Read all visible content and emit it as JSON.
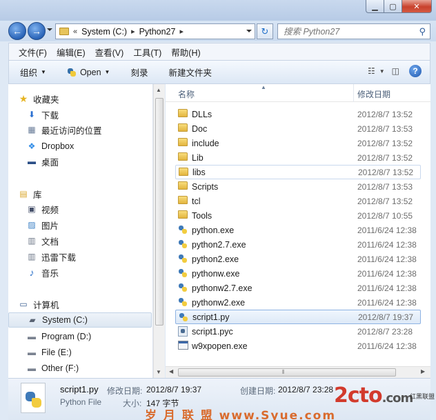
{
  "address": {
    "crumbs": [
      "System (C:)",
      "Python27"
    ],
    "crumb_prefix": "«",
    "search_placeholder": "搜索 Python27"
  },
  "menu": [
    "文件(F)",
    "编辑(E)",
    "查看(V)",
    "工具(T)",
    "帮助(H)"
  ],
  "toolbar": {
    "organize": "组织",
    "open": "Open",
    "burn": "刻录",
    "new_folder": "新建文件夹"
  },
  "nav": {
    "favorites": {
      "header": "收藏夹",
      "items": [
        "下载",
        "最近访问的位置",
        "Dropbox",
        "桌面"
      ]
    },
    "libraries": {
      "header": "库",
      "items": [
        "视频",
        "图片",
        "文档",
        "迅雷下载",
        "音乐"
      ]
    },
    "computer": {
      "header": "计算机",
      "items": [
        "System (C:)",
        "Program (D:)",
        "File (E:)",
        "Other (F:)"
      ]
    }
  },
  "columns": {
    "name": "名称",
    "modified": "修改日期"
  },
  "files": [
    {
      "name": "DLLs",
      "date": "2012/8/7 13:52",
      "kind": "folder"
    },
    {
      "name": "Doc",
      "date": "2012/8/7 13:53",
      "kind": "folder"
    },
    {
      "name": "include",
      "date": "2012/8/7 13:52",
      "kind": "folder"
    },
    {
      "name": "Lib",
      "date": "2012/8/7 13:52",
      "kind": "folder"
    },
    {
      "name": "libs",
      "date": "2012/8/7 13:52",
      "kind": "folder"
    },
    {
      "name": "Scripts",
      "date": "2012/8/7 13:53",
      "kind": "folder"
    },
    {
      "name": "tcl",
      "date": "2012/8/7 13:52",
      "kind": "folder"
    },
    {
      "name": "Tools",
      "date": "2012/8/7 10:55",
      "kind": "folder"
    },
    {
      "name": "python.exe",
      "date": "2011/6/24 12:38",
      "kind": "py"
    },
    {
      "name": "python2.7.exe",
      "date": "2011/6/24 12:38",
      "kind": "py"
    },
    {
      "name": "python2.exe",
      "date": "2011/6/24 12:38",
      "kind": "py"
    },
    {
      "name": "pythonw.exe",
      "date": "2011/6/24 12:38",
      "kind": "py"
    },
    {
      "name": "pythonw2.7.exe",
      "date": "2011/6/24 12:38",
      "kind": "py"
    },
    {
      "name": "pythonw2.exe",
      "date": "2011/6/24 12:38",
      "kind": "py"
    },
    {
      "name": "script1.py",
      "date": "2012/8/7 19:37",
      "kind": "py"
    },
    {
      "name": "script1.pyc",
      "date": "2012/8/7 23:28",
      "kind": "pyc"
    },
    {
      "name": "w9xpopen.exe",
      "date": "2011/6/24 12:38",
      "kind": "exe"
    }
  ],
  "details": {
    "name": "script1.py",
    "type": "Python File",
    "modified_label": "修改日期:",
    "modified_value": "2012/8/7 19:37",
    "created_label": "创建日期:",
    "created_value": "2012/8/7 23:28",
    "size_label": "大小:",
    "size_value": "147 字节"
  },
  "watermark": {
    "logo": "2cto",
    "logo_suffix": ".com",
    "logo_cn": "红黑联盟",
    "bottom": "岁 月 联 盟  www.Syue.com"
  }
}
